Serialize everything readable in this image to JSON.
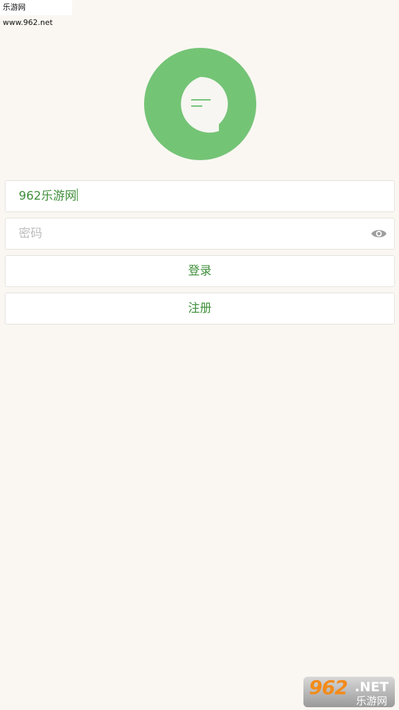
{
  "watermark": {
    "top_text": "乐游网 www.962.net",
    "bottom_number": "962",
    "bottom_suffix": ".NET",
    "bottom_cn": "乐游网"
  },
  "logo": {
    "icon": "chat-bubble-icon",
    "color": "#74c476"
  },
  "login_form": {
    "username_value": "962乐游网",
    "password_placeholder": "密码",
    "password_visibility_icon": "eye-icon",
    "login_label": "登录",
    "register_label": "注册"
  },
  "colors": {
    "background": "#faf7f2",
    "accent_text": "#3f8f3a",
    "placeholder_text": "#bcbcbc"
  }
}
